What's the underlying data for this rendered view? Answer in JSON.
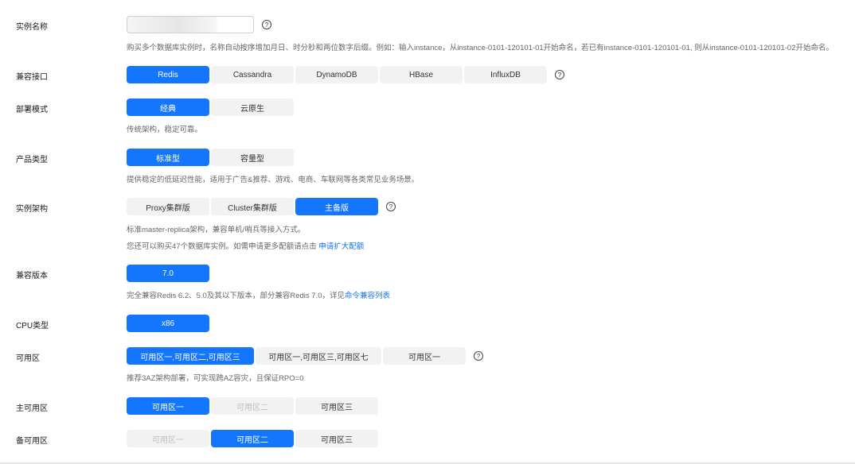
{
  "instance_name": {
    "label": "实例名称",
    "value": "",
    "hint": "购买多个数据库实例时，名称自动按序增加月日、时分秒和两位数字后缀。例如：输入instance，从instance-0101-120101-01开始命名，若已有instance-0101-120101-01, 则从instance-0101-120101-02开始命名。"
  },
  "compat_api": {
    "label": "兼容接口",
    "options": [
      "Redis",
      "Cassandra",
      "DynamoDB",
      "HBase",
      "InfluxDB"
    ],
    "selected": "Redis"
  },
  "deploy_mode": {
    "label": "部署模式",
    "options": [
      "经典",
      "云原生"
    ],
    "selected": "经典",
    "hint": "传统架构，稳定可靠。"
  },
  "product_type": {
    "label": "产品类型",
    "options": [
      "标准型",
      "容量型"
    ],
    "selected": "标准型",
    "hint": "提供稳定的低延迟性能，适用于广告&推荐、游戏、电商、车联网等各类常见业务场景。"
  },
  "architecture": {
    "label": "实例架构",
    "options": [
      "Proxy集群版",
      "Cluster集群版",
      "主备版"
    ],
    "selected": "主备版",
    "hint": "标准master-replica架构，兼容单机/哨兵等接入方式。",
    "quota_text": "您还可以购买47个数据库实例。如需申请更多配额请点击",
    "quota_link": "申请扩大配额"
  },
  "version": {
    "label": "兼容版本",
    "options": [
      "7.0"
    ],
    "selected": "7.0",
    "hint": "完全兼容Redis 6.2、5.0及其以下版本，部分兼容Redis 7.0，详见",
    "hint_link": "命令兼容列表"
  },
  "cpu": {
    "label": "CPU类型",
    "options": [
      "x86"
    ],
    "selected": "x86"
  },
  "az": {
    "label": "可用区",
    "options": [
      "可用区一,可用区二,可用区三",
      "可用区一,可用区三,可用区七",
      "可用区一"
    ],
    "selected": "可用区一,可用区二,可用区三",
    "hint": "推荐3AZ架构部署，可实现跨AZ容灾，且保证RPO=0"
  },
  "primary_az": {
    "label": "主可用区",
    "options": [
      "可用区一",
      "可用区二",
      "可用区三"
    ],
    "selected": "可用区一",
    "disabled": [
      "可用区二"
    ]
  },
  "standby_az": {
    "label": "备可用区",
    "options": [
      "可用区一",
      "可用区二",
      "可用区三"
    ],
    "selected": "可用区二",
    "disabled": [
      "可用区一"
    ]
  },
  "help_icon": "?",
  "colors": {
    "accent": "#1476ff",
    "option_bg": "#f2f2f2"
  }
}
